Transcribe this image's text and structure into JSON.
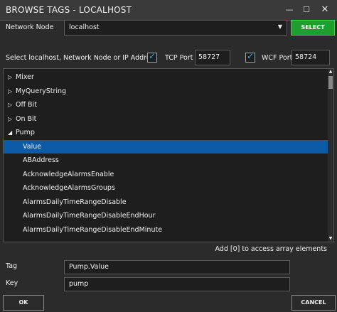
{
  "window": {
    "title": "BROWSE TAGS - LOCALHOST",
    "minimize_icon": "minimize-icon",
    "maximize_icon": "maximize-icon",
    "close_icon": "close-icon"
  },
  "network": {
    "label": "Network Node",
    "selected": "localhost",
    "select_button": "SELECT"
  },
  "options": {
    "instruction": "Select localhost, Network Node or IP Address",
    "tcp": {
      "checked": true,
      "label": "TCP Port",
      "value": "58727"
    },
    "wcf": {
      "checked": true,
      "label": "WCF Port",
      "value": "58724"
    }
  },
  "tree": {
    "items": [
      {
        "label": "Mixer",
        "arrow": "▷",
        "level": 0
      },
      {
        "label": "MyQueryString",
        "arrow": "▷",
        "level": 0
      },
      {
        "label": "Off Bit",
        "arrow": "▷",
        "level": 0
      },
      {
        "label": "On Bit",
        "arrow": "▷",
        "level": 0
      },
      {
        "label": "Pump",
        "arrow": "◢",
        "level": 0
      },
      {
        "label": "Value",
        "arrow": "",
        "level": 1,
        "selected": true
      },
      {
        "label": "ABAddress",
        "arrow": "",
        "level": 1
      },
      {
        "label": "AcknowledgeAlarmsEnable",
        "arrow": "",
        "level": 1
      },
      {
        "label": "AcknowledgeAlarmsGroups",
        "arrow": "",
        "level": 1
      },
      {
        "label": "AlarmsDailyTimeRangeDisable",
        "arrow": "",
        "level": 1
      },
      {
        "label": "AlarmsDailyTimeRangeDisableEndHour",
        "arrow": "",
        "level": 1
      },
      {
        "label": "AlarmsDailyTimeRangeDisableEndMinute",
        "arrow": "",
        "level": 1
      }
    ]
  },
  "hint": "Add [0] to access array elements",
  "fields": {
    "tag_label": "Tag",
    "tag_value": "Pump.Value",
    "key_label": "Key",
    "key_value": "pump"
  },
  "buttons": {
    "ok": "OK",
    "cancel": "CANCEL"
  },
  "colors": {
    "accent": "#0d5aa7",
    "select_green": "#1e9e2e",
    "check": "#3aa0ff"
  }
}
